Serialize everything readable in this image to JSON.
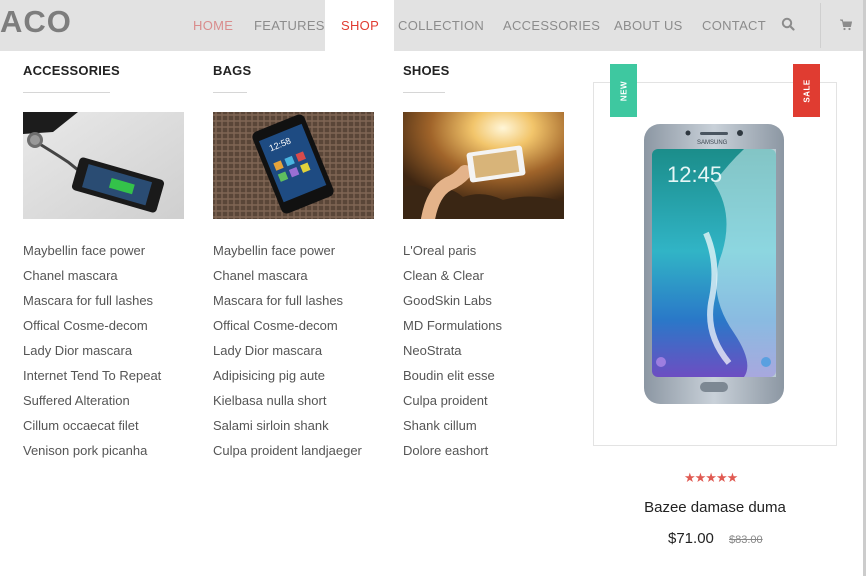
{
  "header": {
    "logo_text": "ACO",
    "nav": [
      {
        "label": "HOME"
      },
      {
        "label": "FEATURES"
      },
      {
        "label": "SHOP"
      },
      {
        "label": "COLLECTION"
      },
      {
        "label": "ACCESSORIES"
      },
      {
        "label": "ABOUT US"
      },
      {
        "label": "CONTACT"
      }
    ],
    "icons": [
      "search-icon",
      "cart-icon"
    ]
  },
  "menu": {
    "columns": [
      {
        "title": "ACCESSORIES",
        "image": "phone-charging-photo",
        "links": [
          "Maybellin face power",
          "Chanel mascara",
          "Mascara for full lashes",
          "Offical Cosme-decom",
          "Lady Dior mascara",
          "Internet Tend To Repeat",
          "Suffered Alteration",
          "Cillum occaecat filet",
          "Venison pork picanha"
        ]
      },
      {
        "title": "BAGS",
        "image": "smartphone-on-mat-photo",
        "links": [
          "Maybellin face power",
          "Chanel mascara",
          "Mascara for full lashes",
          "Offical Cosme-decom",
          "Lady Dior mascara",
          "Adipisicing pig aute",
          "Kielbasa nulla short",
          "Salami sirloin shank",
          "Culpa proident landjaeger"
        ]
      },
      {
        "title": "SHOES",
        "image": "phone-in-sunset-photo",
        "links": [
          "L'Oreal paris",
          "Clean & Clear",
          "GoodSkin Labs",
          "MD Formulations",
          "NeoStrata",
          "Boudin elit esse",
          "Culpa proident",
          "Shank cillum",
          "Dolore eashort"
        ]
      }
    ]
  },
  "product": {
    "badge_new": "NEW",
    "badge_sale": "SALE",
    "rating": 4.5,
    "stars": "★★★★★",
    "name": "Bazee damase duma",
    "price": "$71.00",
    "old_price": "$83.00",
    "phone_brand": "SAMSUNG",
    "phone_time": "12:45"
  },
  "colors": {
    "accent": "#e03c31",
    "new_badge": "#3ec8a0",
    "header_bg": "#e2e2e2"
  }
}
